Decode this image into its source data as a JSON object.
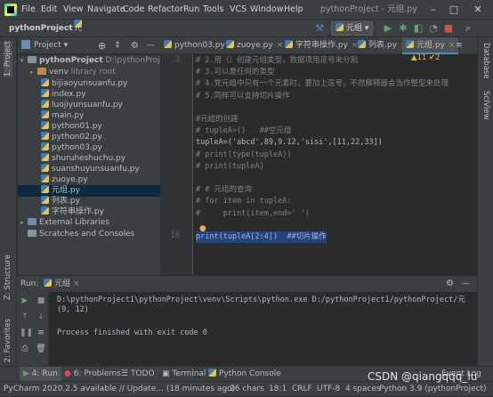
{
  "titlebar": {
    "menus": [
      "File",
      "Edit",
      "View",
      "Navigate",
      "Code",
      "Refactor",
      "Run",
      "Tools",
      "VCS",
      "Window",
      "Help"
    ],
    "window_title": "pythonProject - 元组.py"
  },
  "navbar": {
    "project": "pythonProject",
    "file": "元组.py",
    "run_config": "元组"
  },
  "project_panel": {
    "title": "Project",
    "root_name": "pythonProject",
    "root_path": "D:\\pythonProject1\\p",
    "venv": "venv",
    "venv_hint": "library root",
    "files": [
      "bijiaoyunsuanfu.py",
      "index.py",
      "luojiyunsuanfu.py",
      "main.py",
      "python01.py",
      "python02.py",
      "python03.py",
      "shuruheshuchu.py",
      "suanshuyunsuanfu.py",
      "zuoye.py",
      "元组.py",
      "列表.py",
      "字符串操作.py"
    ],
    "external": "External Libraries",
    "scratches": "Scratches and Consoles"
  },
  "tabs": [
    "python03.py",
    "zuoye.py",
    "字符串操作.py",
    "列表.py",
    "元组.py"
  ],
  "left_strip": {
    "project": "1: Project",
    "structure": "Z: Structure",
    "favorites": "2: Favorites"
  },
  "right_strip": {
    "database": "Database",
    "sciview": "SciView"
  },
  "editor": {
    "warnings": "▲11 ✔2",
    "lines": [
      {
        "n": "3",
        "text": "# 2.用（）创建元组类型，数据项用逗号来分割",
        "cls": "cm"
      },
      {
        "n": "",
        "text": "# 3.可以是任何的类型",
        "cls": "cm"
      },
      {
        "n": "",
        "text": "# 4.党元组中只有一个元素时，要加上逗号，不然解释器会当作整型来处理",
        "cls": "cm"
      },
      {
        "n": "",
        "text": "# 5.同样可以支持切片操作",
        "cls": "cm"
      },
      {
        "n": "",
        "text": "",
        "cls": ""
      },
      {
        "n": "",
        "text": "#元组的创建",
        "cls": "cm"
      },
      {
        "n": "",
        "text": "# tupleA=()   ##空元组",
        "cls": "cm"
      },
      {
        "n": "",
        "text": "tupleA=('abcd',89,9.12,'sisi',[11,22,33])",
        "cls": "code"
      },
      {
        "n": "",
        "text": "# print(type(tupleA))",
        "cls": "cm"
      },
      {
        "n": "",
        "text": "# print(tupleA)",
        "cls": "cm"
      },
      {
        "n": "",
        "text": "",
        "cls": ""
      },
      {
        "n": "",
        "text": "# # 元组的查询",
        "cls": "cm"
      },
      {
        "n": "",
        "text": "# for item in tupleA:",
        "cls": "cm"
      },
      {
        "n": "",
        "text": "#     print(item,end=' ')",
        "cls": "cm"
      },
      {
        "n": "",
        "text": "",
        "cls": ""
      },
      {
        "n": "18",
        "text": "print(tupleA[2:4])  ##切片操作",
        "cls": "cur"
      }
    ]
  },
  "run_panel": {
    "label": "Run:",
    "config": "元组",
    "output": [
      "D:\\pythonProject1\\pythonProject\\venv\\Scripts\\python.exe D:/pythonProject1/pythonProject/元",
      "(9, 12)",
      "",
      "Process finished with exit code 0"
    ]
  },
  "bottom_tabs": [
    "4: Run",
    "6: Problems",
    "TODO",
    "Terminal",
    "Python Console"
  ],
  "event_log": "Event Log",
  "status": {
    "message": "PyCharm 2020.2.5 available // Update... (18 minutes ago)",
    "chars": "26 chars",
    "pos": "18:1",
    "crlf": "CRLF",
    "enc": "UTF-8",
    "indent": "4 spaces",
    "interp": "Python 3.9 (pythonProject)"
  },
  "watermark": "CSDN @qiangqqq_lu"
}
